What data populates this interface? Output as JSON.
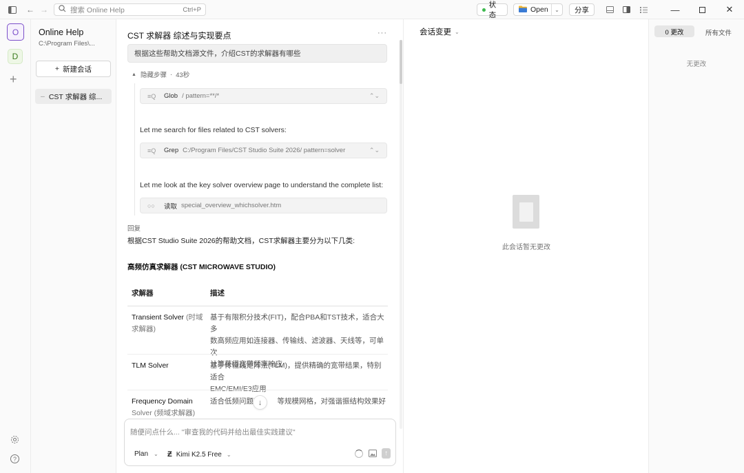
{
  "titlebar": {
    "search_placeholder": "搜索 Online Help",
    "search_shortcut": "Ctrl+P",
    "status_label": "状态",
    "open_label": "Open",
    "share_label": "分享"
  },
  "rail": {
    "workspaces": [
      "O",
      "D"
    ]
  },
  "sidebar": {
    "title": "Online Help",
    "path": "C:\\Program Files\\...",
    "new_session_label": "新建会话",
    "sessions": [
      {
        "label": "CST 求解器 综..."
      }
    ]
  },
  "chat": {
    "title": "CST 求解器 综述与实现要点",
    "user_message": "根据这些帮助文档源文件，介绍CST的求解器有哪些",
    "steps_toggle": "隐藏步骤",
    "steps_duration": "43秒",
    "steps": [
      {
        "tool": "Glob",
        "detail": "/  pattern=**/*"
      },
      {
        "text": "Let me search for files related to CST solvers:"
      },
      {
        "tool": "Grep",
        "detail": "C:/Program Files/CST Studio Suite 2026/  pattern=solver"
      },
      {
        "text": "Let me look at the key solver overview page to understand the complete list:"
      },
      {
        "tool": "读取",
        "detail": "special_overview_whichsolver.htm"
      }
    ],
    "reply_label": "回复",
    "reply_intro": "根据CST Studio Suite 2026的帮助文档，CST求解器主要分为以下几类:",
    "section_title": "高频仿真求解器 (CST MICROWAVE STUDIO)",
    "table_headers": [
      "求解器",
      "描述"
    ],
    "table_rows": [
      {
        "name": "Transient Solver",
        "sub": "(时域",
        "sub2": "求解器)",
        "desc": [
          "基于有限积分技术(FIT)，配合PBA和TST技术，适合大多",
          "数高频应用如连接器、传输线、滤波器、天线等，可单次",
          "计算获得宽带频率响应"
        ]
      },
      {
        "name": "TLM Solver",
        "sub": "",
        "sub2": "",
        "desc": [
          "基于传输线矩阵法(TLM)，提供精确的宽带结果，特别适合",
          "EMC/EMI/E3应用"
        ]
      },
      {
        "name": "Frequency Domain",
        "sub": "",
        "sub2": "Solver (频域求解器)",
        "desc": [
          "适合低频问题和",
          "等规模网格，对强谐振结构效果好"
        ]
      }
    ],
    "input_placeholder": "随便问点什么... \"审查我的代码并给出最佳实践建议\"",
    "mode_label": "Plan",
    "model_label": "Kimi K2.5 Free"
  },
  "changes": {
    "title": "会话变更",
    "empty_text": "此会话暂无更改"
  },
  "files": {
    "tab_changes": "0 更改",
    "tab_all": "所有文件",
    "empty_text": "无更改"
  },
  "colors": {
    "accent_purple": "#7b4fc9",
    "workspace_d_bg": "#eef7e6",
    "status_green": "#3fb950"
  }
}
